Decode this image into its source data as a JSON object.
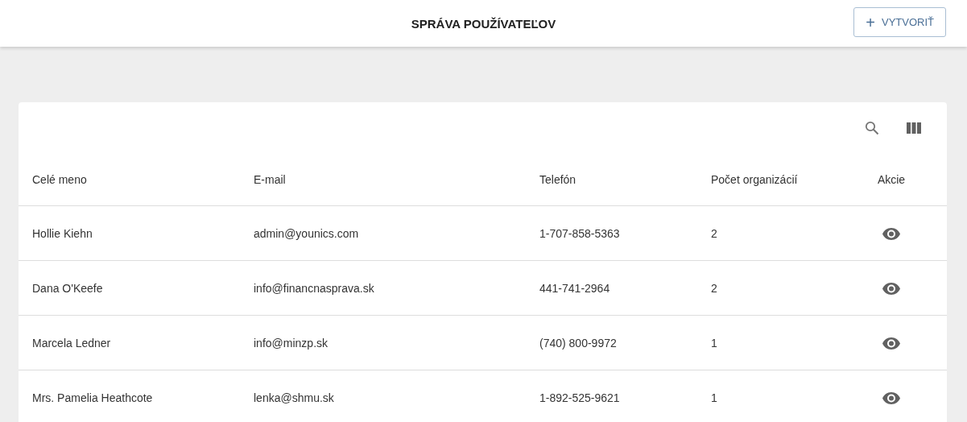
{
  "header": {
    "title": "SPRÁVA POUŽÍVATEĽOV",
    "create_button": {
      "icon": "+",
      "label": "VYTVORIŤ"
    }
  },
  "table": {
    "columns": [
      "Celé meno",
      "E-mail",
      "Telefón",
      "Počet organizácií",
      "Akcie"
    ],
    "rows": [
      {
        "name": "Hollie Kiehn",
        "email": "admin@younics.com",
        "phone": "1-707-858-5363",
        "organizations": "2"
      },
      {
        "name": "Dana O'Keefe",
        "email": "info@financnasprava.sk",
        "phone": "441-741-2964",
        "organizations": "2"
      },
      {
        "name": "Marcela Ledner",
        "email": "info@minzp.sk",
        "phone": "(740) 800-9972",
        "organizations": "1"
      },
      {
        "name": "Mrs. Pamelia Heathcote",
        "email": "lenka@shmu.sk",
        "phone": "1-892-525-9621",
        "organizations": "1"
      }
    ]
  }
}
